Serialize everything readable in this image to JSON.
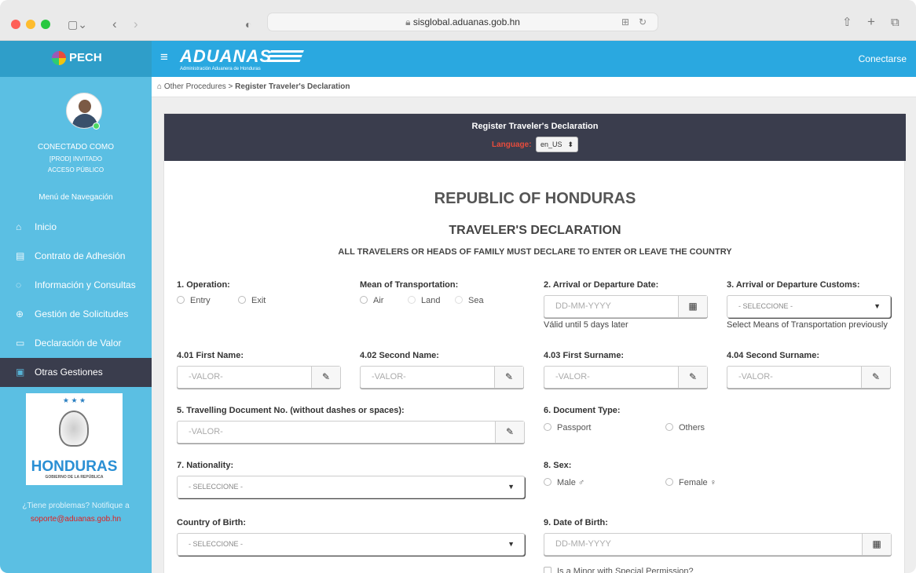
{
  "browser": {
    "url": "sisglobal.aduanas.gob.hn"
  },
  "header": {
    "brand": "PECH",
    "menu_icon": "≡",
    "logo_title": "ADUANAS",
    "logo_subtitle": "Administración Aduanera de Honduras",
    "login_label": "Conectarse"
  },
  "breadcrumb": {
    "parent": "Other Procedures",
    "separator": ">",
    "current": "Register Traveler's Declaration"
  },
  "sidebar": {
    "status_title": "CONECTADO COMO",
    "user": "[PROD] INVITADO",
    "access": "ACCESO PÚBLICO",
    "nav_heading": "Menú de Navegación",
    "items": [
      {
        "label": "Inicio",
        "icon": "home-icon"
      },
      {
        "label": "Contrato de Adhesión",
        "icon": "contract-icon"
      },
      {
        "label": "Información y Consultas",
        "icon": "chat-icon"
      },
      {
        "label": "Gestión de Solicitudes",
        "icon": "globe-icon"
      },
      {
        "label": "Declaración de Valor",
        "icon": "document-icon"
      },
      {
        "label": "Otras Gestiones",
        "icon": "card-icon",
        "active": true
      }
    ],
    "country_logo": "HONDURAS",
    "country_sub": "GOBIERNO DE LA REPÚBLICA",
    "help_text": "¿Tiene problemas? Notifique a",
    "help_email": "soporte@aduanas.gob.hn"
  },
  "card": {
    "title": "Register Traveler's Declaration",
    "language_label": "Language:",
    "language_value": "en_US"
  },
  "form": {
    "heading": "REPUBLIC OF HONDURAS",
    "subheading": "TRAVELER'S DECLARATION",
    "instruction": "ALL TRAVELERS OR HEADS OF FAMILY MUST DECLARE TO ENTER OR LEAVE THE COUNTRY",
    "operation": {
      "label": "1. Operation:",
      "options": [
        "Entry",
        "Exit"
      ]
    },
    "transport": {
      "label": "Mean of Transportation:",
      "options": [
        "Air",
        "Land",
        "Sea"
      ]
    },
    "arrival_date": {
      "label": "2. Arrival or Departure Date:",
      "placeholder": "DD-MM-YYYY",
      "note": "Válid until 5 days later"
    },
    "customs": {
      "label": "3. Arrival or Departure Customs:",
      "value": "- SELECCIONE -",
      "note": "Select Means of Transportation previously"
    },
    "first_name": {
      "label": "4.01 First Name:",
      "placeholder": "-VALOR-"
    },
    "second_name": {
      "label": "4.02 Second Name:",
      "placeholder": "-VALOR-"
    },
    "first_surname": {
      "label": "4.03 First Surname:",
      "placeholder": "-VALOR-"
    },
    "second_surname": {
      "label": "4.04 Second Surname:",
      "placeholder": "-VALOR-"
    },
    "document_no": {
      "label": "5. Travelling Document No. (without dashes or spaces):",
      "placeholder": "-VALOR-"
    },
    "doc_type": {
      "label": "6. Document Type:",
      "options": [
        "Passport",
        "Others"
      ]
    },
    "nationality": {
      "label": "7. Nationality:",
      "value": "- SELECCIONE -"
    },
    "sex": {
      "label": "8. Sex:",
      "options": [
        "Male ♂",
        "Female ♀"
      ]
    },
    "country_birth": {
      "label": "Country of Birth:",
      "value": "- SELECCIONE -"
    },
    "birth_date": {
      "label": "9. Date of Birth:",
      "placeholder": "DD-MM-YYYY"
    },
    "minor": {
      "label": "Is a Minor with Special Permission?"
    }
  },
  "colors": {
    "topbar": "#2aa8e0",
    "sidebar": "#5bbfe3",
    "active_nav": "#3a3d4d",
    "card_header": "#3a3d4d",
    "language_label": "#e74c3c",
    "help_email": "#e02020"
  }
}
